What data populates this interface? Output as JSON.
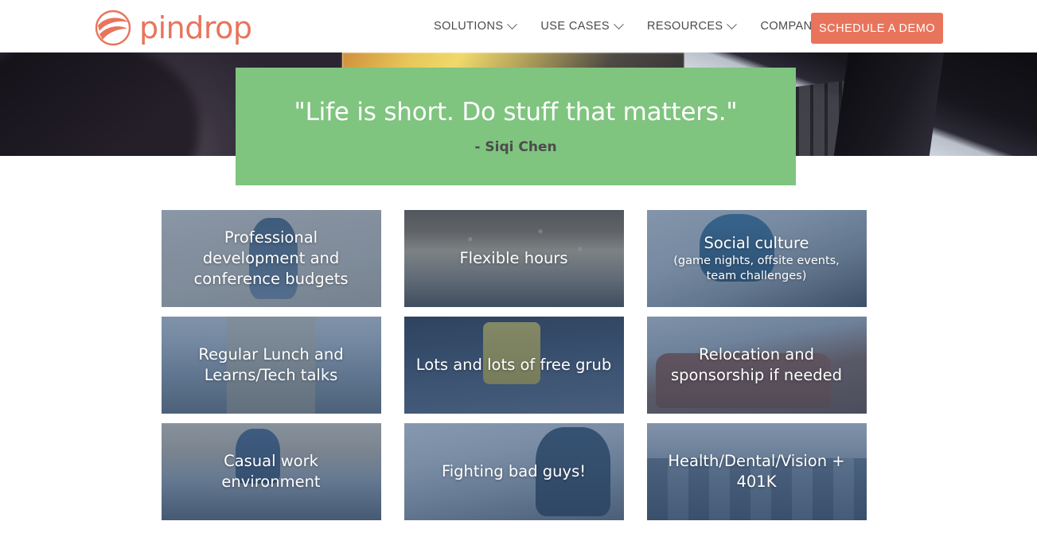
{
  "header": {
    "logo": {
      "text": "pindrop",
      "icon": "pindrop-logo-icon",
      "color": "#E8745C"
    },
    "nav": [
      {
        "label": "SOLUTIONS",
        "has_dropdown": true
      },
      {
        "label": "USE CASES",
        "has_dropdown": true
      },
      {
        "label": "RESOURCES",
        "has_dropdown": true
      },
      {
        "label": "COMPANY",
        "has_dropdown": true
      }
    ],
    "cta": {
      "label": "SCHEDULE A DEMO",
      "color": "#E8745C"
    }
  },
  "hero": {
    "quote": "\"Life is short. Do stuff that matters.\"",
    "author": "- Siqi Chen",
    "banner_color": "#7FC47F"
  },
  "perks": {
    "overlay_color": "#3E5A7C",
    "cards": [
      {
        "title": "Professional development and conference budgets",
        "subtitle": ""
      },
      {
        "title": "Flexible hours",
        "subtitle": ""
      },
      {
        "title": "Social culture",
        "subtitle": "(game nights, offsite events, team challenges)"
      },
      {
        "title": "Regular Lunch and Learns/Tech talks",
        "subtitle": ""
      },
      {
        "title": "Lots and lots of free grub",
        "subtitle": ""
      },
      {
        "title": "Relocation and sponsorship if needed",
        "subtitle": ""
      },
      {
        "title": "Casual work environment",
        "subtitle": ""
      },
      {
        "title": "Fighting bad guys!",
        "subtitle": ""
      },
      {
        "title": "Health/Dental/Vision + 401K",
        "subtitle": ""
      }
    ]
  }
}
